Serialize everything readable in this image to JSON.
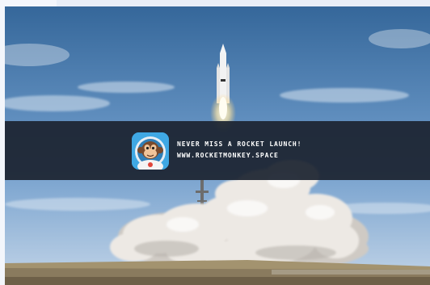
{
  "banner": {
    "headline": "NEVER MISS A ROCKET LAUNCH!",
    "url": "WWW.ROCKETMONKEY.SPACE"
  },
  "icons": {
    "app_icon": "monkey-astronaut-icon"
  },
  "colors": {
    "banner_bg": "#1c2430",
    "sky_top": "#3f6fa0",
    "sky_bottom": "#b7cde4",
    "smoke": "#ede9e4",
    "flame": "#fff2c8",
    "ground": "#8a7b5e"
  }
}
